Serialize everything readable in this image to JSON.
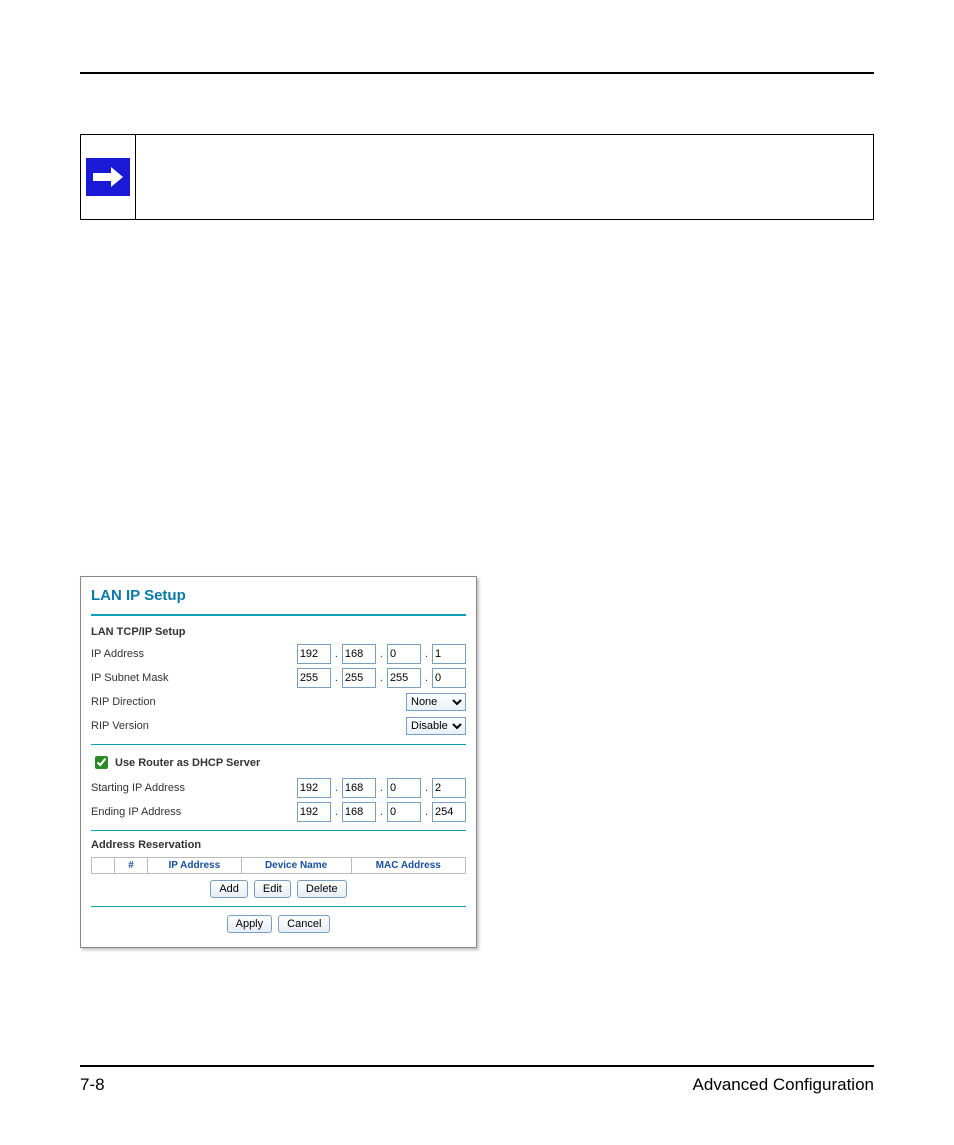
{
  "footer": {
    "page": "7-8",
    "section": "Advanced Configuration"
  },
  "panel": {
    "title": "LAN IP Setup",
    "tcpip": {
      "heading": "LAN TCP/IP Setup",
      "ip_label": "IP Address",
      "ip": [
        "192",
        "168",
        "0",
        "1"
      ],
      "mask_label": "IP Subnet Mask",
      "mask": [
        "255",
        "255",
        "255",
        "0"
      ],
      "rip_dir_label": "RIP Direction",
      "rip_dir_value": "None",
      "rip_ver_label": "RIP Version",
      "rip_ver_value": "Disable"
    },
    "dhcp": {
      "checkbox_label": "Use Router as DHCP Server",
      "checked": true,
      "start_label": "Starting IP Address",
      "start": [
        "192",
        "168",
        "0",
        "2"
      ],
      "end_label": "Ending IP Address",
      "end": [
        "192",
        "168",
        "0",
        "254"
      ]
    },
    "reservation": {
      "heading": "Address Reservation",
      "cols": {
        "num": "#",
        "ip": "IP Address",
        "device": "Device Name",
        "mac": "MAC Address"
      },
      "buttons": {
        "add": "Add",
        "edit": "Edit",
        "delete": "Delete"
      }
    },
    "actions": {
      "apply": "Apply",
      "cancel": "Cancel"
    }
  }
}
